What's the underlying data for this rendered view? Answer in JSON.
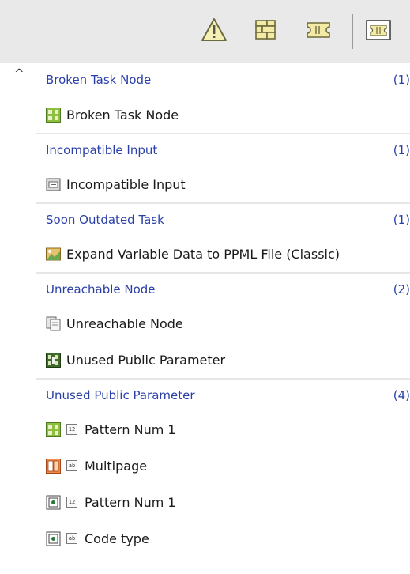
{
  "toolbar": {
    "buttons": [
      {
        "name": "warning-icon"
      },
      {
        "name": "broken-brick-icon"
      },
      {
        "name": "ticket-icon"
      },
      {
        "name": "panel-icon"
      }
    ]
  },
  "groups": [
    {
      "title": "Broken Task Node",
      "count": "(1)",
      "items": [
        {
          "icon": "task-node-icon",
          "label": "Broken Task Node"
        }
      ]
    },
    {
      "title": "Incompatible Input",
      "count": "(1)",
      "items": [
        {
          "icon": "input-icon",
          "label": "Incompatible Input"
        }
      ]
    },
    {
      "title": "Soon Outdated Task",
      "count": "(1)",
      "items": [
        {
          "icon": "ppml-task-icon",
          "label": "Expand Variable Data to PPML File (Classic)"
        }
      ]
    },
    {
      "title": "Unreachable Node",
      "count": "(2)",
      "items": [
        {
          "icon": "unreachable-node-icon",
          "label": "Unreachable Node"
        },
        {
          "icon": "public-parameter-icon",
          "label": "Unused Public Parameter"
        }
      ]
    },
    {
      "title": "Unused Public Parameter",
      "count": "(4)",
      "items": [
        {
          "icon": "task-node-icon",
          "type_icon": "numeric-type-icon",
          "type_text": "12",
          "label": "Pattern Num 1"
        },
        {
          "icon": "multipage-node-icon",
          "type_icon": "text-type-icon",
          "type_text": "ab",
          "label": "Multipage"
        },
        {
          "icon": "barcode-node-icon",
          "type_icon": "numeric-type-icon",
          "type_text": "12",
          "label": "Pattern Num 1"
        },
        {
          "icon": "barcode-node-icon",
          "type_icon": "text-type-icon",
          "type_text": "ab",
          "label": "Code type"
        }
      ]
    }
  ],
  "colors": {
    "link": "#2a3fa8",
    "toolbar_bg": "#e9e9e9"
  }
}
